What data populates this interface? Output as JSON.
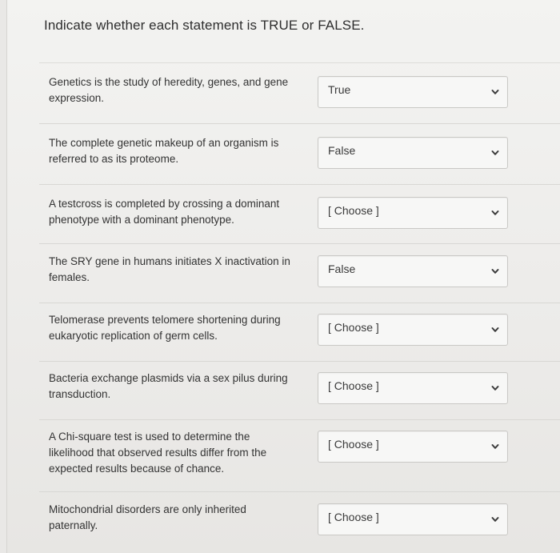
{
  "instructions": "Indicate whether each statement is TRUE or FALSE.",
  "questions": [
    {
      "statement": "Genetics is the study of heredity, genes, and gene expression.",
      "selected": "True"
    },
    {
      "statement": "The complete genetic makeup of an organism is referred to as its proteome.",
      "selected": "False"
    },
    {
      "statement": "A testcross is completed by crossing a dominant phenotype with a dominant phenotype.",
      "selected": "[ Choose ]"
    },
    {
      "statement": "The SRY gene in humans initiates X inactivation in females.",
      "selected": "False"
    },
    {
      "statement": "Telomerase prevents telomere shortening during eukaryotic replication of germ cells.",
      "selected": "[ Choose ]"
    },
    {
      "statement": "Bacteria exchange plasmids via a sex pilus during transduction.",
      "selected": "[ Choose ]"
    },
    {
      "statement": "A Chi-square test is used to determine the likelihood that observed results differ from the expected results because of chance.",
      "selected": "[ Choose ]"
    },
    {
      "statement": "Mitochondrial disorders are only inherited paternally.",
      "selected": "[ Choose ]"
    }
  ],
  "colors": {
    "chevron": "#3b3b3b"
  },
  "icons": {
    "dropdown": "chevron-down-icon"
  }
}
